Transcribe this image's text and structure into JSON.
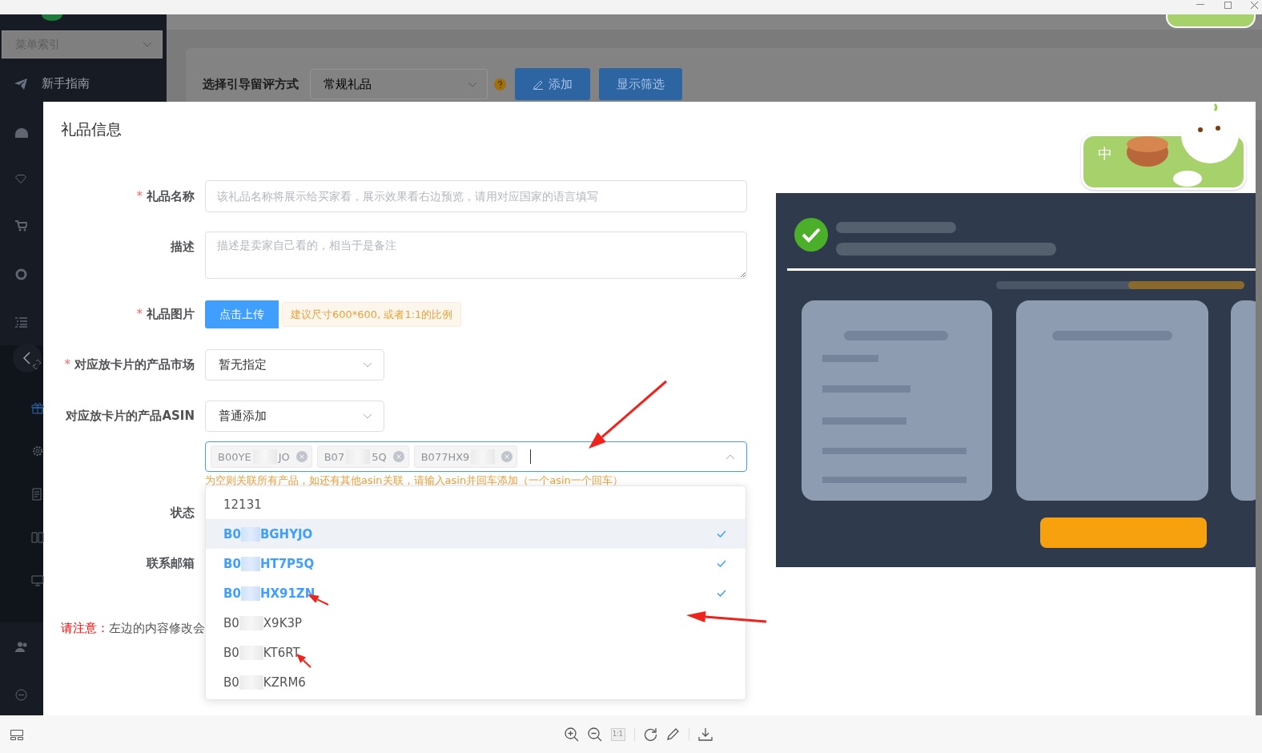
{
  "page_toolbar": {
    "label": "选择引导留评方式",
    "mode_select": {
      "value": "常规礼品"
    },
    "buttons": [
      {
        "label": "添加",
        "kind": "add"
      },
      {
        "label": "显示筛选",
        "kind": "plain"
      }
    ]
  },
  "sidebar": {
    "menu_index": {
      "placeholder": "菜单索引"
    },
    "guide": {
      "label": "新手指南"
    },
    "submenu_items": [
      {
        "selected": false
      },
      {
        "selected": true
      },
      {
        "selected": false
      },
      {
        "selected": false
      },
      {
        "selected": false
      },
      {
        "selected": false
      }
    ]
  },
  "dialog": {
    "title": "礼品信息",
    "name_field": {
      "label": "礼品名称",
      "required_mark": "*",
      "placeholder": "该礼品名称将展示给买家看，展示效果看右边预览，请用对应国家的语言填写"
    },
    "description_field": {
      "label": "描述",
      "placeholder": "描述是卖家自己看的，相当于是备注"
    },
    "image_field": {
      "label": "礼品图片",
      "required_mark": "*",
      "button": "点击上传",
      "hint": "建议尺寸600*600, 或者1:1的比例"
    },
    "market_field": {
      "label": "对应放卡片的产品市场",
      "required_mark": "*",
      "value": "暂无指定"
    },
    "asin_field": {
      "label": "对应放卡片的产品ASIN",
      "value": "普通添加"
    },
    "asin_tags": [
      {
        "start": "B00YE",
        "end": "JO"
      },
      {
        "start": "B07",
        "end": "5Q"
      },
      {
        "start": "B077HX9"
      }
    ],
    "asin_hint": "为空则关联所有产品，如还有其他asin关联，请输入asin并回车添加（一个asin一个回车）",
    "asin_options": [
      {
        "start": "12131",
        "selected": false,
        "hovered": false
      },
      {
        "start": "B0",
        "end": "BGHYJO",
        "selected": true,
        "hovered": true
      },
      {
        "start": "B0",
        "end": "HT7P5Q",
        "selected": true,
        "hovered": false
      },
      {
        "start": "B0",
        "end": "HX91ZN",
        "selected": true,
        "hovered": false
      },
      {
        "start": "B0",
        "end": "X9K3P",
        "selected": false,
        "hovered": false
      },
      {
        "start": "B0",
        "end": "KT6RT",
        "selected": false,
        "hovered": false
      },
      {
        "start": "B0",
        "end": "KZRM6",
        "selected": false,
        "hovered": false
      }
    ],
    "status_label": "状态",
    "email_label": "联系邮箱",
    "note": {
      "prefix": "请注意：",
      "text": "左边的内容修改会"
    }
  },
  "ime_widget": {
    "mode": "中"
  },
  "viewer_toolbar": {
    "actual_size": {
      "label": "1:1",
      "disabled": true
    }
  }
}
